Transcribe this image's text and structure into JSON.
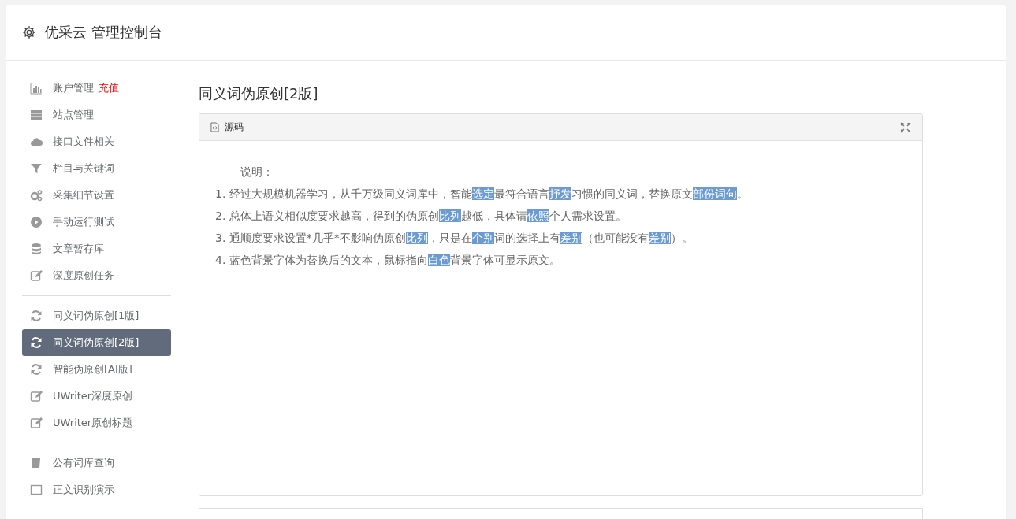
{
  "header": {
    "title": "优采云 管理控制台"
  },
  "sidebar": {
    "groups": [
      {
        "items": [
          {
            "label": "账户管理",
            "badge": "充值",
            "selected": false
          },
          {
            "label": "站点管理",
            "selected": false
          },
          {
            "label": "接口文件相关",
            "selected": false
          },
          {
            "label": "栏目与关键词",
            "selected": false
          },
          {
            "label": "采集细节设置",
            "selected": false
          },
          {
            "label": "手动运行测试",
            "selected": false
          },
          {
            "label": "文章暂存库",
            "selected": false
          },
          {
            "label": "深度原创任务",
            "selected": false
          }
        ]
      },
      {
        "items": [
          {
            "label": "同义词伪原创[1版]",
            "selected": false
          },
          {
            "label": "同义词伪原创[2版]",
            "selected": true
          },
          {
            "label": "智能伪原创[AI版]",
            "selected": false
          },
          {
            "label": "UWriter深度原创",
            "selected": false
          },
          {
            "label": "UWriter原创标题",
            "selected": false
          }
        ]
      },
      {
        "items": [
          {
            "label": "公有词库查询",
            "selected": false
          },
          {
            "label": "正文识别演示",
            "selected": false
          }
        ]
      }
    ]
  },
  "main": {
    "title": "同义词伪原创[2版]",
    "editor": {
      "toolbar_label": "源码",
      "heading": "说明：",
      "lines": [
        [
          {
            "text": "1. 经过大规模机器学习，从千万级同义词库中，智能",
            "highlighted": false
          },
          {
            "text": "选定",
            "highlighted": true
          },
          {
            "text": "最符合语言",
            "highlighted": false
          },
          {
            "text": "抒发",
            "highlighted": true
          },
          {
            "text": "习惯的同义词，替换原文",
            "highlighted": false
          },
          {
            "text": "部份",
            "highlighted": true
          },
          {
            "text": "词句",
            "highlighted": true
          },
          {
            "text": "。",
            "highlighted": false
          }
        ],
        [
          {
            "text": "2. 总体上语义相似度要求越高，得到的伪原创",
            "highlighted": false
          },
          {
            "text": "比列",
            "highlighted": true
          },
          {
            "text": "越低，具体请",
            "highlighted": false
          },
          {
            "text": "依照",
            "highlighted": true
          },
          {
            "text": "个人需求设置。",
            "highlighted": false
          }
        ],
        [
          {
            "text": "3. 通顺度要求设置*几乎*不影响伪原创",
            "highlighted": false
          },
          {
            "text": "比列",
            "highlighted": true
          },
          {
            "text": "，只是在",
            "highlighted": false
          },
          {
            "text": "个别",
            "highlighted": true
          },
          {
            "text": "词的选择上有",
            "highlighted": false
          },
          {
            "text": "差别",
            "highlighted": true
          },
          {
            "text": "（也可能没有",
            "highlighted": false
          },
          {
            "text": "差别",
            "highlighted": true
          },
          {
            "text": "）。",
            "highlighted": false
          }
        ],
        [
          {
            "text": "4. 蓝色背景字体为替换后的文本，鼠标指向",
            "highlighted": false
          },
          {
            "text": "白色",
            "highlighted": true
          },
          {
            "text": "背景字体可显示原文。",
            "highlighted": false
          }
        ]
      ]
    }
  }
}
